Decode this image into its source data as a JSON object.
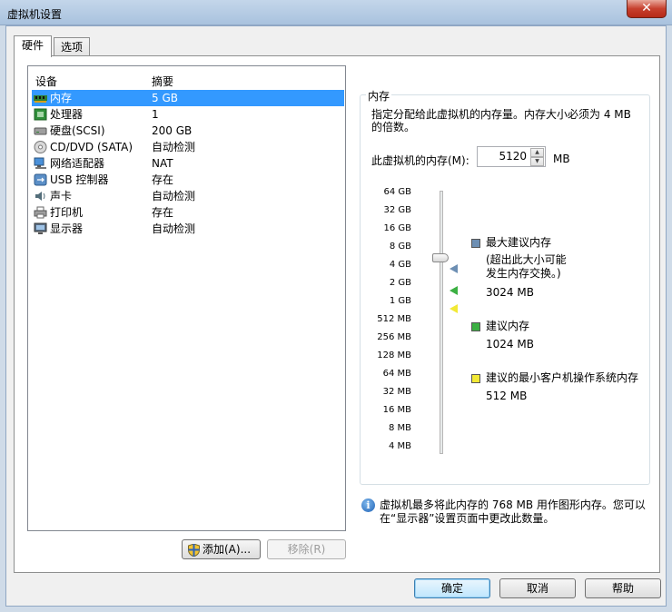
{
  "window": {
    "title": "虚拟机设置",
    "close_glyph": "✕"
  },
  "tabs": [
    {
      "label": "硬件",
      "active": true
    },
    {
      "label": "选项",
      "active": false
    }
  ],
  "device_list": {
    "columns": {
      "device": "设备",
      "summary": "摘要"
    },
    "rows": [
      {
        "name": "内存",
        "summary": "5 GB",
        "icon": "memory-icon",
        "selected": true
      },
      {
        "name": "处理器",
        "summary": "1",
        "icon": "processor-icon"
      },
      {
        "name": "硬盘(SCSI)",
        "summary": "200 GB",
        "icon": "hard-disk-icon"
      },
      {
        "name": "CD/DVD (SATA)",
        "summary": "自动检测",
        "icon": "cd-dvd-icon"
      },
      {
        "name": "网络适配器",
        "summary": "NAT",
        "icon": "network-adapter-icon"
      },
      {
        "name": "USB 控制器",
        "summary": "存在",
        "icon": "usb-icon"
      },
      {
        "name": "声卡",
        "summary": "自动检测",
        "icon": "sound-card-icon"
      },
      {
        "name": "打印机",
        "summary": "存在",
        "icon": "printer-icon"
      },
      {
        "name": "显示器",
        "summary": "自动检测",
        "icon": "display-icon"
      }
    ],
    "add_button": "添加(A)...",
    "remove_button": "移除(R)"
  },
  "memory": {
    "group_title": "内存",
    "description": "指定分配给此虚拟机的内存量。内存大小必须为 4 MB 的倍数。",
    "field_label": "此虚拟机的内存(M):",
    "value": "5120",
    "unit": "MB",
    "scale": [
      "64 GB",
      "32 GB",
      "16 GB",
      "8 GB",
      "4 GB",
      "2 GB",
      "1 GB",
      "512 MB",
      "256 MB",
      "128 MB",
      "64 MB",
      "32 MB",
      "16 MB",
      "8 MB",
      "4 MB"
    ],
    "legend": {
      "max_recommended": {
        "title": "最大建议内存",
        "note_line1": "(超出此大小可能",
        "note_line2": "发生内存交换。)",
        "value": "3024 MB",
        "color": "#6d8fb3"
      },
      "recommended": {
        "title": "建议内存",
        "value": "1024 MB",
        "color": "#3cb043"
      },
      "guest_min": {
        "title": "建议的最小客户机操作系统内存",
        "value": "512 MB",
        "color": "#f2e935"
      }
    },
    "info_text": "虚拟机最多将此内存的 768 MB 用作图形内存。您可以在“显示器”设置页面中更改此数量。"
  },
  "buttons": {
    "ok": "确定",
    "cancel": "取消",
    "help": "帮助"
  }
}
